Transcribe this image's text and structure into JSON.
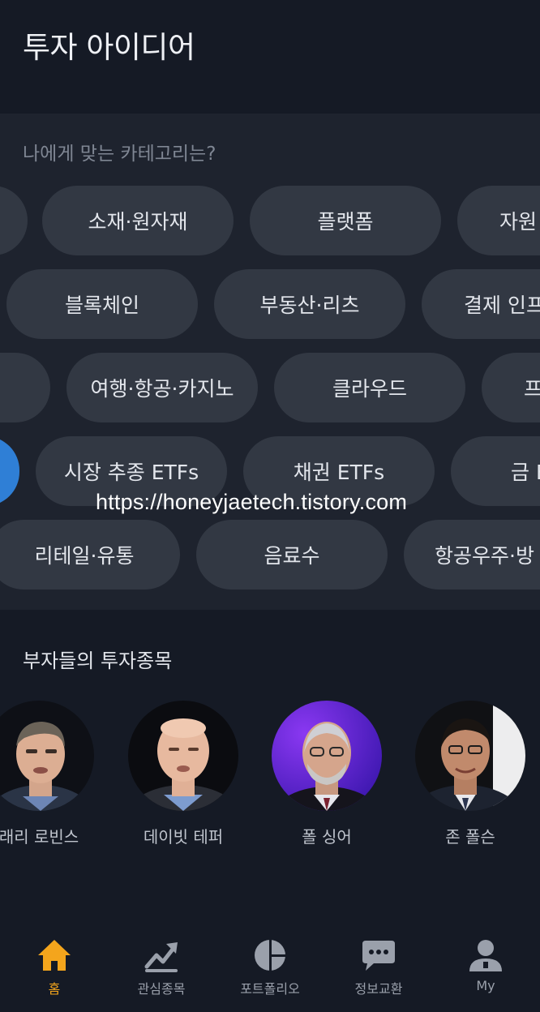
{
  "header": {
    "title": "투자 아이디어"
  },
  "categories": {
    "question": "나에게 맞는 카테고리는?",
    "rows": [
      [
        "",
        "소재·원자재",
        "플랫폼",
        "자원"
      ],
      [
        "블록체인",
        "부동산·리츠",
        "결제 인프"
      ],
      [
        "",
        "여행·항공·카지노",
        "클라우드",
        "프"
      ],
      [
        "",
        "시장 추종 ETFs",
        "채권 ETFs",
        "금 E"
      ],
      [
        "리테일·유통",
        "음료수",
        "항공우주·방"
      ]
    ]
  },
  "watermark": "https://honeyjaetech.tistory.com",
  "investors": {
    "title": "부자들의 투자종목",
    "items": [
      {
        "name": "래리 로빈스"
      },
      {
        "name": "데이빗 테퍼"
      },
      {
        "name": "폴 싱어"
      },
      {
        "name": "존 폴슨"
      }
    ]
  },
  "tabbar": {
    "items": [
      {
        "label": "홈",
        "icon": "home-icon",
        "active": true
      },
      {
        "label": "관심종목",
        "icon": "trend-chart-icon"
      },
      {
        "label": "포트폴리오",
        "icon": "pie-chart-icon"
      },
      {
        "label": "정보교환",
        "icon": "chat-bubble-icon"
      },
      {
        "label": "My",
        "icon": "user-icon"
      }
    ],
    "active_color": "#f4a51c",
    "inactive_color": "#9aa0ab"
  }
}
